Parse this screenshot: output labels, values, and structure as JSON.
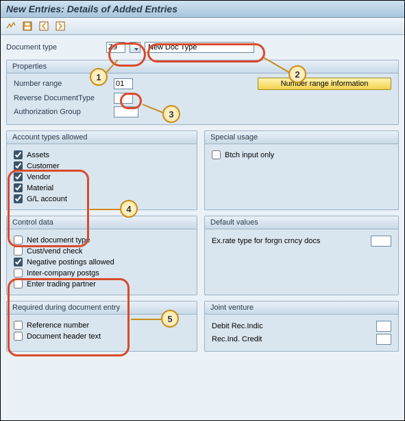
{
  "title": "New Entries: Details of Added Entries",
  "toolbar": {
    "tool1": "glasses-icon",
    "tool2": "save-icon",
    "tool3": "prev-icon",
    "tool4": "next-icon"
  },
  "docType": {
    "label": "Document type",
    "code": "Z9",
    "desc": "New Doc Type"
  },
  "properties": {
    "header": "Properties",
    "numberRange": {
      "label": "Number range",
      "value": "01"
    },
    "reverseDocType": {
      "label": "Reverse DocumentType",
      "value": ""
    },
    "authGroup": {
      "label": "Authorization Group",
      "value": ""
    },
    "nrInfoBtn": "Number range information"
  },
  "accountTypes": {
    "header": "Account types allowed",
    "items": [
      {
        "label": "Assets",
        "checked": true
      },
      {
        "label": "Customer",
        "checked": true
      },
      {
        "label": "Vendor",
        "checked": true
      },
      {
        "label": "Material",
        "checked": true
      },
      {
        "label": "G/L account",
        "checked": true
      }
    ]
  },
  "specialUsage": {
    "header": "Special usage",
    "items": [
      {
        "label": "Btch input only",
        "checked": false
      }
    ]
  },
  "controlData": {
    "header": "Control data",
    "items": [
      {
        "label": "Net document type",
        "checked": false
      },
      {
        "label": "Cust/vend check",
        "checked": false
      },
      {
        "label": "Negative postings allowed",
        "checked": true
      },
      {
        "label": "Inter-company postgs",
        "checked": false
      },
      {
        "label": "Enter trading partner",
        "checked": false
      }
    ]
  },
  "defaultValues": {
    "header": "Default values",
    "exRateLabel": "Ex.rate type for forgn crncy docs"
  },
  "required": {
    "header": "Required during document entry",
    "items": [
      {
        "label": "Reference number",
        "checked": false
      },
      {
        "label": "Document header text",
        "checked": false
      }
    ]
  },
  "jointVenture": {
    "header": "Joint venture",
    "debitLabel": "Debit Rec.Indic",
    "creditLabel": "Rec.Ind. Credit"
  },
  "annotations": {
    "c1": "1",
    "c2": "2",
    "c3": "3",
    "c4": "4",
    "c5": "5"
  }
}
